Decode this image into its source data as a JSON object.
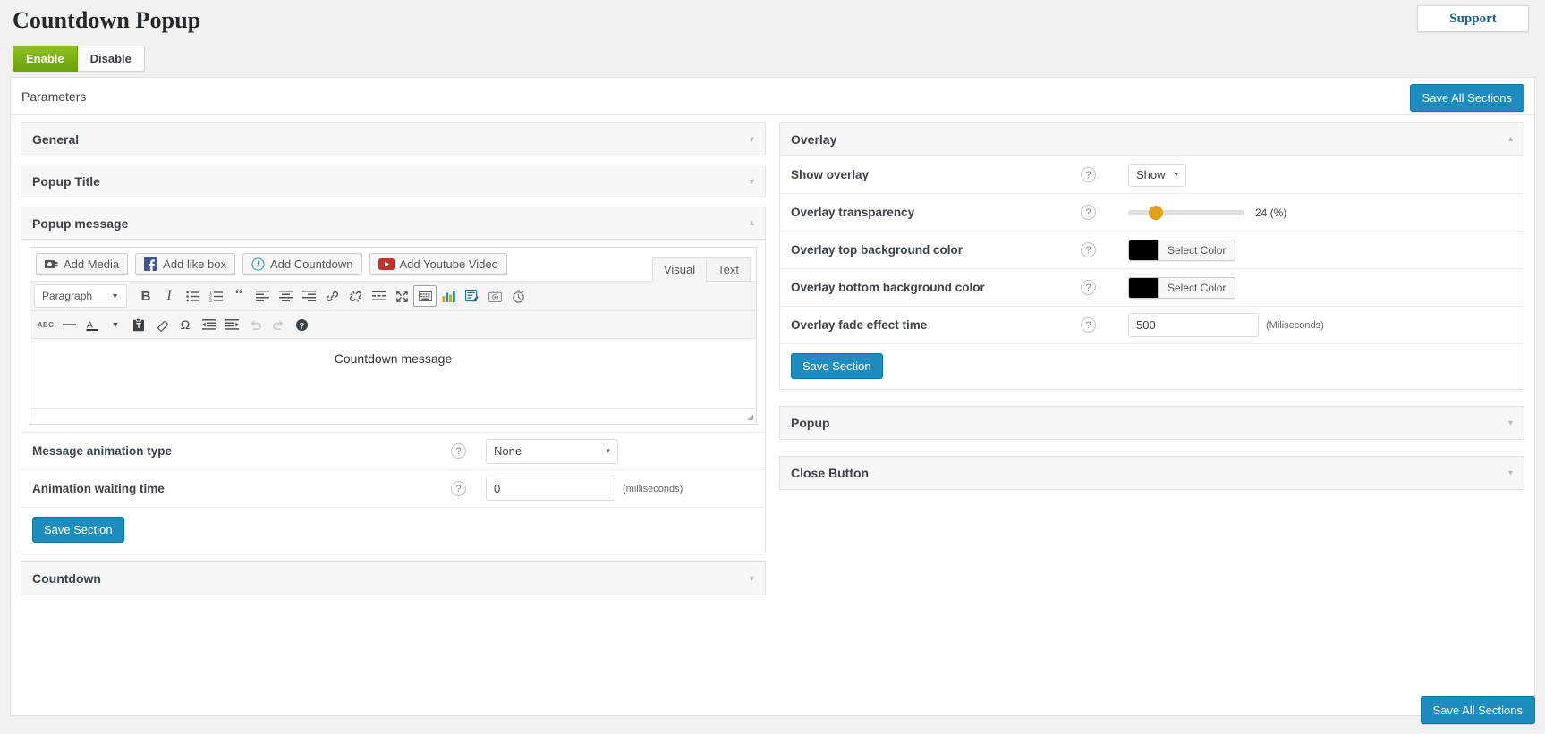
{
  "header": {
    "title": "Countdown Popup",
    "support_label": "Support",
    "enable_label": "Enable",
    "disable_label": "Disable"
  },
  "parameters": {
    "label": "Parameters",
    "save_all_label": "Save All Sections",
    "save_all_bottom_label": "Save All Sections"
  },
  "left": {
    "general": {
      "title": "General",
      "caret": "▾"
    },
    "popup_title": {
      "title": "Popup Title",
      "caret": "▾"
    },
    "popup_message": {
      "title": "Popup message",
      "caret": "▴",
      "media_buttons": [
        {
          "label": "Add Media",
          "icon": "camera-icon"
        },
        {
          "label": "Add like box",
          "icon": "facebook-icon"
        },
        {
          "label": "Add Countdown",
          "icon": "clock-icon"
        },
        {
          "label": "Add Youtube Video",
          "icon": "youtube-icon"
        }
      ],
      "tabs": [
        {
          "label": "Visual",
          "active": true
        },
        {
          "label": "Text",
          "active": false
        }
      ],
      "toolbar_row1": {
        "format_select": "Paragraph",
        "buttons": [
          {
            "name": "bold-icon",
            "glyph": "B"
          },
          {
            "name": "italic-icon",
            "glyph": "I"
          },
          {
            "name": "bulleted-list-icon",
            "glyph": "☰"
          },
          {
            "name": "numbered-list-icon",
            "glyph": "≡"
          },
          {
            "name": "blockquote-icon",
            "glyph": "❝"
          },
          {
            "name": "align-left-icon",
            "glyph": "≡"
          },
          {
            "name": "align-center-icon",
            "glyph": "≡"
          },
          {
            "name": "align-right-icon",
            "glyph": "≡"
          },
          {
            "name": "insert-link-icon",
            "glyph": "🔗"
          },
          {
            "name": "remove-link-icon",
            "glyph": "✂"
          },
          {
            "name": "read-more-icon",
            "glyph": "═"
          },
          {
            "name": "fullscreen-icon",
            "glyph": "⤡"
          },
          {
            "name": "toolbar-toggle-icon",
            "glyph": "⌨"
          },
          {
            "name": "insert-chart-icon",
            "glyph": "📊"
          },
          {
            "name": "insert-form-icon",
            "glyph": "📝"
          },
          {
            "name": "insert-screenshot-icon",
            "glyph": "📷"
          },
          {
            "name": "insert-timer-icon",
            "glyph": "⏱"
          }
        ]
      },
      "toolbar_row2": [
        {
          "name": "strikethrough-icon",
          "glyph": "ABC"
        },
        {
          "name": "horizontal-rule-icon",
          "glyph": "—"
        },
        {
          "name": "text-color-icon",
          "glyph": "A"
        },
        {
          "name": "text-color-dropdown-icon",
          "glyph": "▾"
        },
        {
          "name": "paste-as-text-icon",
          "glyph": "📋"
        },
        {
          "name": "clear-formatting-icon",
          "glyph": "⊘"
        },
        {
          "name": "special-character-icon",
          "glyph": "Ω"
        },
        {
          "name": "outdent-icon",
          "glyph": "←"
        },
        {
          "name": "indent-icon",
          "glyph": "→"
        },
        {
          "name": "undo-icon",
          "glyph": "↶"
        },
        {
          "name": "redo-icon",
          "glyph": "↷"
        },
        {
          "name": "keyboard-shortcuts-icon",
          "glyph": "?"
        }
      ],
      "content": "Countdown message",
      "rows": [
        {
          "label": "Message animation type",
          "help": "?",
          "control": "select",
          "value": "None",
          "caret": "▾",
          "unit": ""
        },
        {
          "label": "Animation waiting time",
          "help": "?",
          "control": "text",
          "value": "0",
          "unit": "(milliseconds)"
        }
      ],
      "save_section_label": "Save Section"
    },
    "countdown": {
      "title": "Countdown",
      "caret": "▾"
    }
  },
  "right": {
    "overlay": {
      "title": "Overlay",
      "caret": "▴",
      "rows": [
        {
          "label": "Show overlay",
          "help": "?",
          "control": "select",
          "value": "Show",
          "caret": "▾",
          "unit": ""
        },
        {
          "label": "Overlay transparency",
          "help": "?",
          "control": "slider",
          "value": "24",
          "slider_percent": 24,
          "unit": "(%)",
          "display": "24 (%)"
        },
        {
          "label": "Overlay top background color",
          "help": "?",
          "control": "color",
          "value": "#000000",
          "button_label": "Select Color",
          "unit": ""
        },
        {
          "label": "Overlay bottom background color",
          "help": "?",
          "control": "color",
          "value": "#000000",
          "button_label": "Select Color",
          "unit": ""
        },
        {
          "label": "Overlay fade effect time",
          "help": "?",
          "control": "text",
          "value": "500",
          "unit": "(Miliseconds)"
        }
      ],
      "save_section_label": "Save Section"
    },
    "popup": {
      "title": "Popup",
      "caret": "▾"
    },
    "close_button": {
      "title": "Close Button",
      "caret": "▾"
    }
  },
  "colors": {
    "accent_blue": "#1e8cbe",
    "enable_green": "#7ab317",
    "slider_thumb": "#e0a019",
    "support_text": "#1f6290"
  }
}
